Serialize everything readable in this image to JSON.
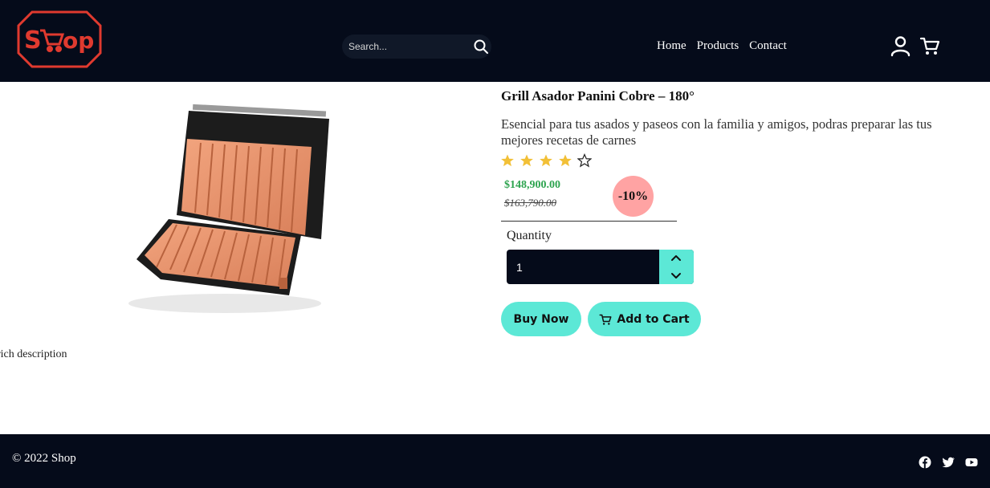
{
  "header": {
    "logo_text": "Shop",
    "search": {
      "placeholder": "Search..."
    },
    "nav": [
      {
        "label": "Home"
      },
      {
        "label": "Products"
      },
      {
        "label": "Contact"
      }
    ]
  },
  "product": {
    "title": "Grill Asador Panini Cobre – 180°",
    "description": "Esencial para tus asados y paseos con la familia y amigos, podras preparar las tus mejores recetas de carnes",
    "rating": 4,
    "rating_max": 5,
    "price": "$148,900.00",
    "old_price": "$163,790.00",
    "discount": "-10%",
    "quantity_label": "Quantity",
    "quantity_value": "1",
    "buy_label": "Buy Now",
    "cart_label": "Add to Cart",
    "rich_description": "rich description"
  },
  "footer": {
    "copyright": "© 2022 Shop"
  },
  "colors": {
    "dark": "#050b1a",
    "accent": "#5ce8d6",
    "logo_red": "#e03a2f",
    "star": "#f2c037",
    "price_green": "#2ea44f",
    "discount_pink": "#ffa3a3"
  }
}
